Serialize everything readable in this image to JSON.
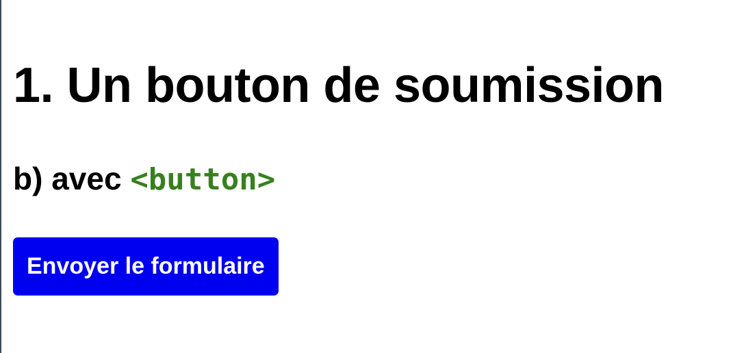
{
  "heading": {
    "title": "1. Un bouton de soumission"
  },
  "subheading": {
    "prefix": "b) avec ",
    "code": "<button>"
  },
  "form": {
    "submit_label": "Envoyer le formulaire"
  },
  "colors": {
    "code_text": "#38801f",
    "button_background": "#0000f0",
    "button_text": "#ffffff"
  }
}
